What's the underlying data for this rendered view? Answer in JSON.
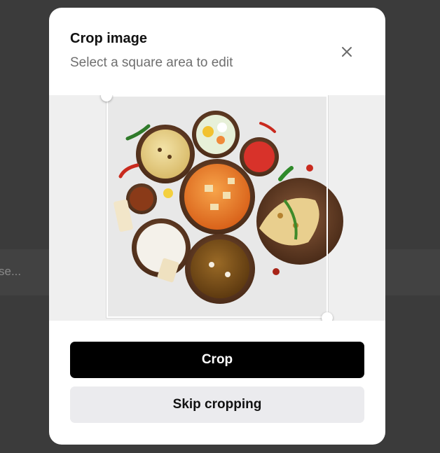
{
  "background": {
    "partial_text": "se..."
  },
  "modal": {
    "title": "Crop image",
    "subtitle": "Select a square area to edit",
    "close_icon": "close-icon"
  },
  "image": {
    "subject": "food-photo",
    "selection_shape": "square"
  },
  "buttons": {
    "crop_label": "Crop",
    "skip_label": "Skip cropping"
  },
  "colors": {
    "primary_button": "#000000",
    "secondary_button": "#ebebee",
    "backdrop": "#3b3b3b"
  }
}
